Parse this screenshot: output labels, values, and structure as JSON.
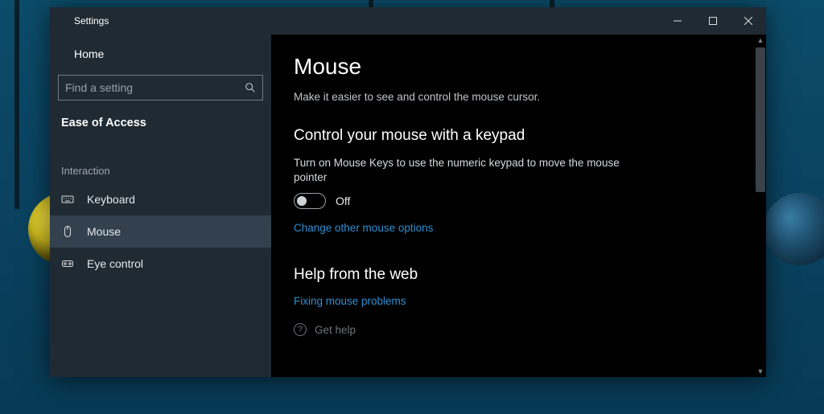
{
  "window": {
    "title": "Settings"
  },
  "sidebar": {
    "home_label": "Home",
    "search_placeholder": "Find a setting",
    "category": "Ease of Access",
    "section_heading": "Interaction",
    "items": [
      {
        "id": "keyboard",
        "label": "Keyboard",
        "selected": false
      },
      {
        "id": "mouse",
        "label": "Mouse",
        "selected": true
      },
      {
        "id": "eyecontrol",
        "label": "Eye control",
        "selected": false
      }
    ]
  },
  "main": {
    "title": "Mouse",
    "subtitle": "Make it easier to see and control the mouse cursor.",
    "section1": {
      "heading": "Control your mouse with a keypad",
      "desc": "Turn on Mouse Keys to use the numeric keypad to move the mouse pointer",
      "toggle_state": "Off",
      "link": "Change other mouse options"
    },
    "help": {
      "heading": "Help from the web",
      "link": "Fixing mouse problems",
      "get_help": "Get help"
    }
  }
}
